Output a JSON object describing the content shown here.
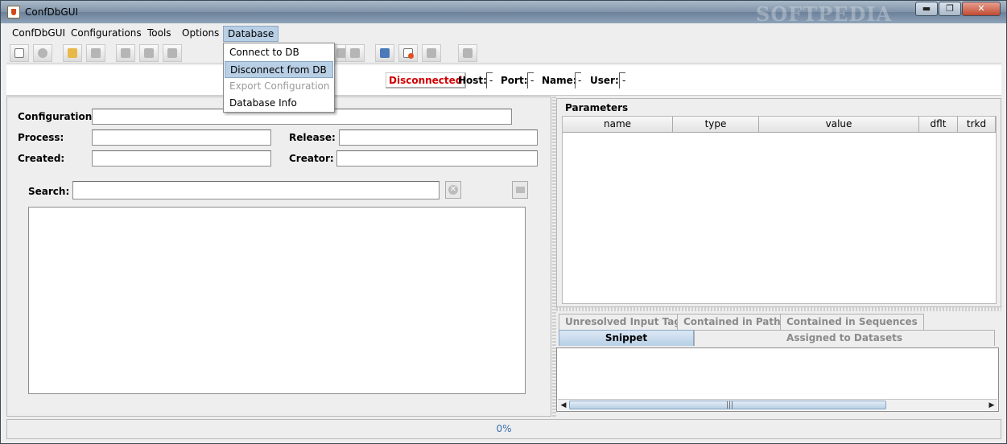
{
  "window": {
    "title": "ConfDbGUI",
    "watermark": "SOFTPEDIA",
    "min_label": "▬",
    "max_label": "❐",
    "close_label": "✕"
  },
  "menubar": {
    "items": [
      "ConfDbGUI",
      "Configurations",
      "Tools",
      "Options",
      "Database"
    ],
    "active": "Database"
  },
  "database_menu": {
    "items": [
      {
        "label": "Connect to DB",
        "state": "normal"
      },
      {
        "label": "Disconnect from DB",
        "state": "highlighted"
      },
      {
        "label": "Export Configuration",
        "state": "disabled"
      },
      {
        "label": "Database Info",
        "state": "normal"
      }
    ]
  },
  "connection": {
    "status": "Disconnected",
    "status_color": "#d00000",
    "host_label": "Host:",
    "host_value": "-",
    "port_label": "Port:",
    "port_value": "-",
    "name_label": "Name:",
    "name_value": "-",
    "user_label": "User:",
    "user_value": "-"
  },
  "config_form": {
    "configuration_label": "Configuration:",
    "process_label": "Process:",
    "release_label": "Release:",
    "created_label": "Created:",
    "creator_label": "Creator:",
    "search_label": "Search:"
  },
  "parameters": {
    "title": "Parameters",
    "columns": [
      "name",
      "type",
      "value",
      "dflt",
      "trkd"
    ]
  },
  "tabs": {
    "row1": [
      "Unresolved Input Tags",
      "Contained in Paths",
      "Contained in Sequences"
    ],
    "row2": [
      "Snippet",
      "Assigned to Datasets"
    ],
    "selected": "Snippet"
  },
  "scrollbar": {
    "thumb_grip": "|||",
    "left_arrow": "◀",
    "right_arrow": "▶"
  },
  "status": {
    "progress_text": "0%",
    "progress_color": "#3a6fb0"
  },
  "colors": {
    "accent": "#b8cfe5",
    "accent_border": "#8aa7c4"
  }
}
